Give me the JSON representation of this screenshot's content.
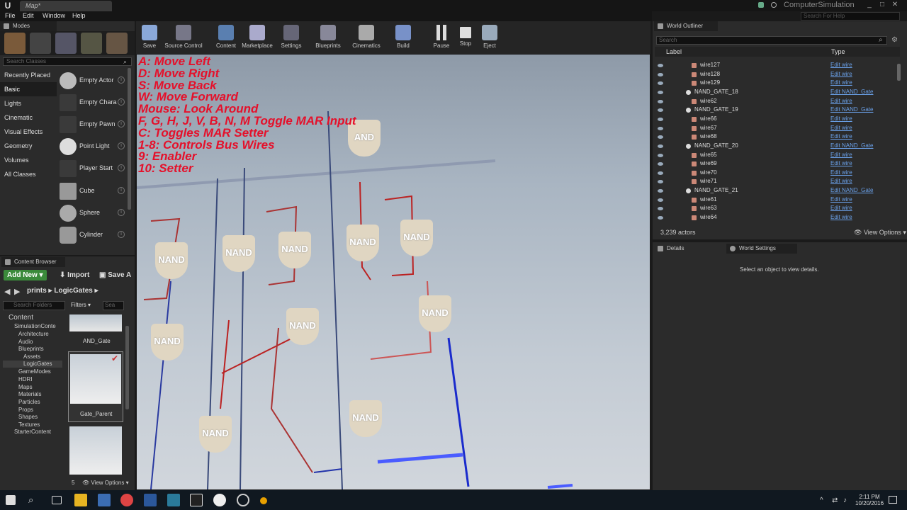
{
  "window": {
    "map_tab": "Map*",
    "project": "ComputerSimulation",
    "search_help_placeholder": "Search For Help"
  },
  "menu": [
    "File",
    "Edit",
    "Window",
    "Help"
  ],
  "modes": {
    "title": "Modes",
    "search_placeholder": "Search Classes",
    "categories": [
      "Recently Placed",
      "Basic",
      "Lights",
      "Cinematic",
      "Visual Effects",
      "Geometry",
      "Volumes",
      "All Classes"
    ],
    "actors": [
      "Empty Actor",
      "Empty Chara",
      "Empty Pawn",
      "Point Light",
      "Player Start",
      "Cube",
      "Sphere",
      "Cylinder"
    ]
  },
  "toolbar": [
    "Save",
    "Source Control",
    "Content",
    "Marketplace",
    "Settings",
    "Blueprints",
    "Cinematics",
    "Build",
    "Pause",
    "Stop",
    "Eject"
  ],
  "help_lines": [
    "A: Move Left",
    "D: Move Right",
    "S: Move Back",
    "W: Move Forward",
    "Mouse: Look Around",
    "F, G, H, J, V, B, N, M Toggle MAR Input",
    "C: Toggles MAR Setter",
    "1-8: Controls Bus Wires",
    "9: Enabler",
    "10: Setter"
  ],
  "gate_labels": {
    "and": "AND",
    "nand": "NAND"
  },
  "content_browser": {
    "title": "Content Browser",
    "add_new": "Add New",
    "import": "Import",
    "save_all": "Save A",
    "path": [
      "prints",
      "LogicGates"
    ],
    "search_folders": "Search Folders",
    "filters": "Filters",
    "search_assets": "Sea",
    "tree": [
      "Content",
      "SimulationConte",
      "Architecture",
      "Audio",
      "Blueprints",
      "Assets",
      "LogicGates",
      "GameModes",
      "HDRI",
      "Maps",
      "Materials",
      "Particles",
      "Props",
      "Shapes",
      "Textures",
      "StarterContent"
    ],
    "assets": [
      "AND_Gate",
      "Gate_Parent"
    ],
    "count": "5",
    "view_options": "View Options"
  },
  "outliner": {
    "title": "World Outliner",
    "search_placeholder": "Search",
    "col_label": "Label",
    "col_type": "Type",
    "rows": [
      {
        "label": "wire127",
        "type": "Edit wire",
        "gate": false
      },
      {
        "label": "wire128",
        "type": "Edit wire",
        "gate": false
      },
      {
        "label": "wire129",
        "type": "Edit wire",
        "gate": false
      },
      {
        "label": "NAND_GATE_18",
        "type": "Edit NAND_Gate",
        "gate": true
      },
      {
        "label": "wire62",
        "type": "Edit wire",
        "gate": false
      },
      {
        "label": "NAND_GATE_19",
        "type": "Edit NAND_Gate",
        "gate": true
      },
      {
        "label": "wire66",
        "type": "Edit wire",
        "gate": false
      },
      {
        "label": "wire67",
        "type": "Edit wire",
        "gate": false
      },
      {
        "label": "wire68",
        "type": "Edit wire",
        "gate": false
      },
      {
        "label": "NAND_GATE_20",
        "type": "Edit NAND_Gate",
        "gate": true
      },
      {
        "label": "wire65",
        "type": "Edit wire",
        "gate": false
      },
      {
        "label": "wire69",
        "type": "Edit wire",
        "gate": false
      },
      {
        "label": "wire70",
        "type": "Edit wire",
        "gate": false
      },
      {
        "label": "wire71",
        "type": "Edit wire",
        "gate": false
      },
      {
        "label": "NAND_GATE_21",
        "type": "Edit NAND_Gate",
        "gate": true
      },
      {
        "label": "wire61",
        "type": "Edit wire",
        "gate": false
      },
      {
        "label": "wire63",
        "type": "Edit wire",
        "gate": false
      },
      {
        "label": "wire64",
        "type": "Edit wire",
        "gate": false
      }
    ],
    "actor_count": "3,239 actors",
    "view_options": "View Options"
  },
  "details": {
    "tab": "Details",
    "tab2": "World Settings",
    "empty": "Select an object to view details."
  },
  "taskbar": {
    "time": "2:11 PM",
    "date": "10/20/2016"
  }
}
